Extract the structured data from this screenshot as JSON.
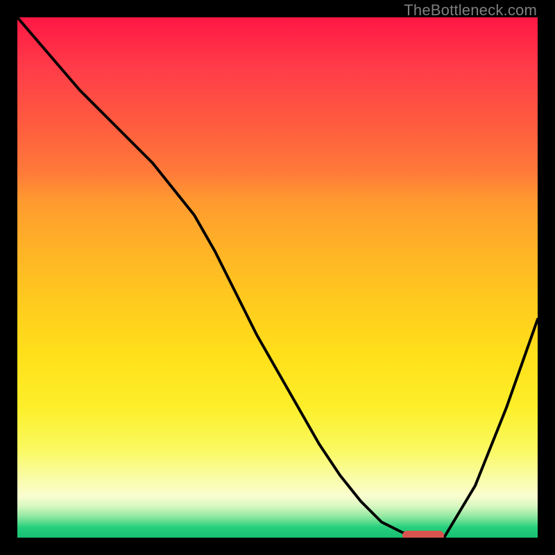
{
  "watermark": "TheBottleneck.com",
  "colors": {
    "background": "#000000",
    "curve": "#000000",
    "marker_fill": "#d9544f",
    "gradient_top": "#ff1744",
    "gradient_bottom": "#18c172"
  },
  "chart_data": {
    "type": "line",
    "title": "",
    "xlabel": "",
    "ylabel": "",
    "xlim": [
      0,
      100
    ],
    "ylim": [
      0,
      100
    ],
    "grid": false,
    "legend": false,
    "series": [
      {
        "name": "bottleneck-curve",
        "x": [
          0,
          6,
          12,
          18,
          22,
          26,
          30,
          34,
          38,
          42,
          46,
          50,
          54,
          58,
          62,
          66,
          70,
          74,
          78,
          82,
          88,
          94,
          100
        ],
        "values": [
          100,
          93,
          86,
          80,
          76,
          72,
          67,
          62,
          55,
          47,
          39,
          32,
          25,
          18,
          12,
          7,
          3,
          1,
          0,
          0,
          10,
          25,
          42
        ]
      }
    ],
    "marker": {
      "x_start": 74,
      "x_end": 82,
      "y": 0
    }
  }
}
